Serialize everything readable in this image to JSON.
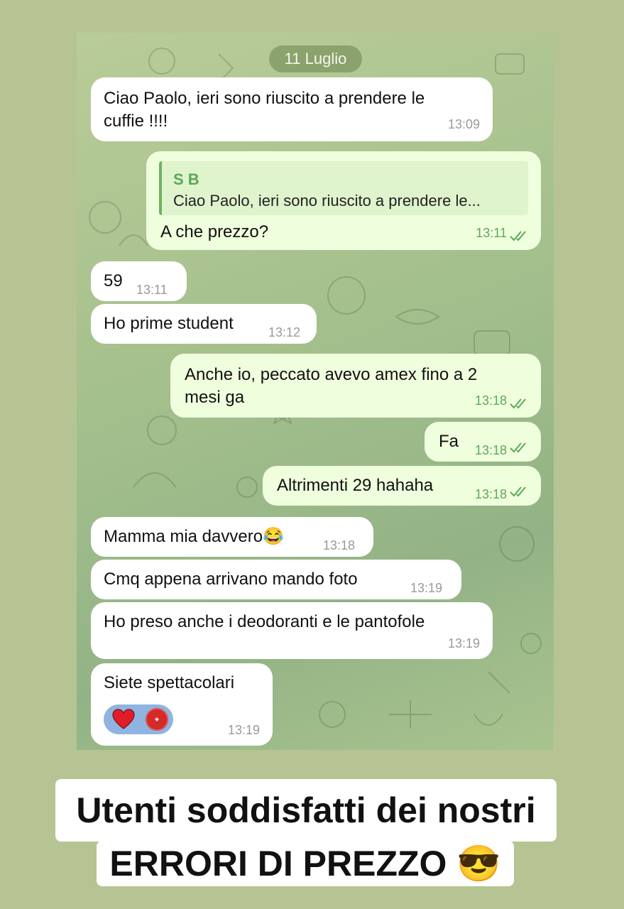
{
  "chat": {
    "date": "11 Luglio",
    "messages": [
      {
        "text": "Ciao Paolo, ieri sono riuscito a prendere le\ncuffie !!!!",
        "time": "13:09"
      },
      {
        "reply_name": "S B",
        "reply_text": "Ciao Paolo, ieri sono riuscito a prendere le...",
        "text": "A che prezzo?",
        "time": "13:11"
      },
      {
        "text": "59",
        "time": "13:11"
      },
      {
        "text": "Ho prime student",
        "time": "13:12"
      },
      {
        "text": "Anche io, peccato avevo amex fino a 2\nmesi ga",
        "time": "13:18"
      },
      {
        "text": "Fa",
        "time": "13:18"
      },
      {
        "text": "Altrimenti 29 hahaha",
        "time": "13:18"
      },
      {
        "text": "Mamma mia davvero😂",
        "time": "13:18"
      },
      {
        "text": "Cmq appena arrivano mando foto",
        "time": "13:19"
      },
      {
        "text": "Ho preso anche i deodoranti e le pantofole",
        "time": "13:19"
      },
      {
        "text": "Siete spettacolari",
        "time": "13:19",
        "reactions": [
          "heart",
          "heart-avatar"
        ]
      }
    ]
  },
  "caption": {
    "line1": "Utenti soddisfatti dei nostri",
    "line2": "ERRORI DI PREZZO 😎"
  },
  "colors": {
    "background": "#b6c493",
    "incoming_bubble": "#ffffff",
    "outgoing_bubble": "#effedd",
    "accent_green": "#5fa85a"
  }
}
